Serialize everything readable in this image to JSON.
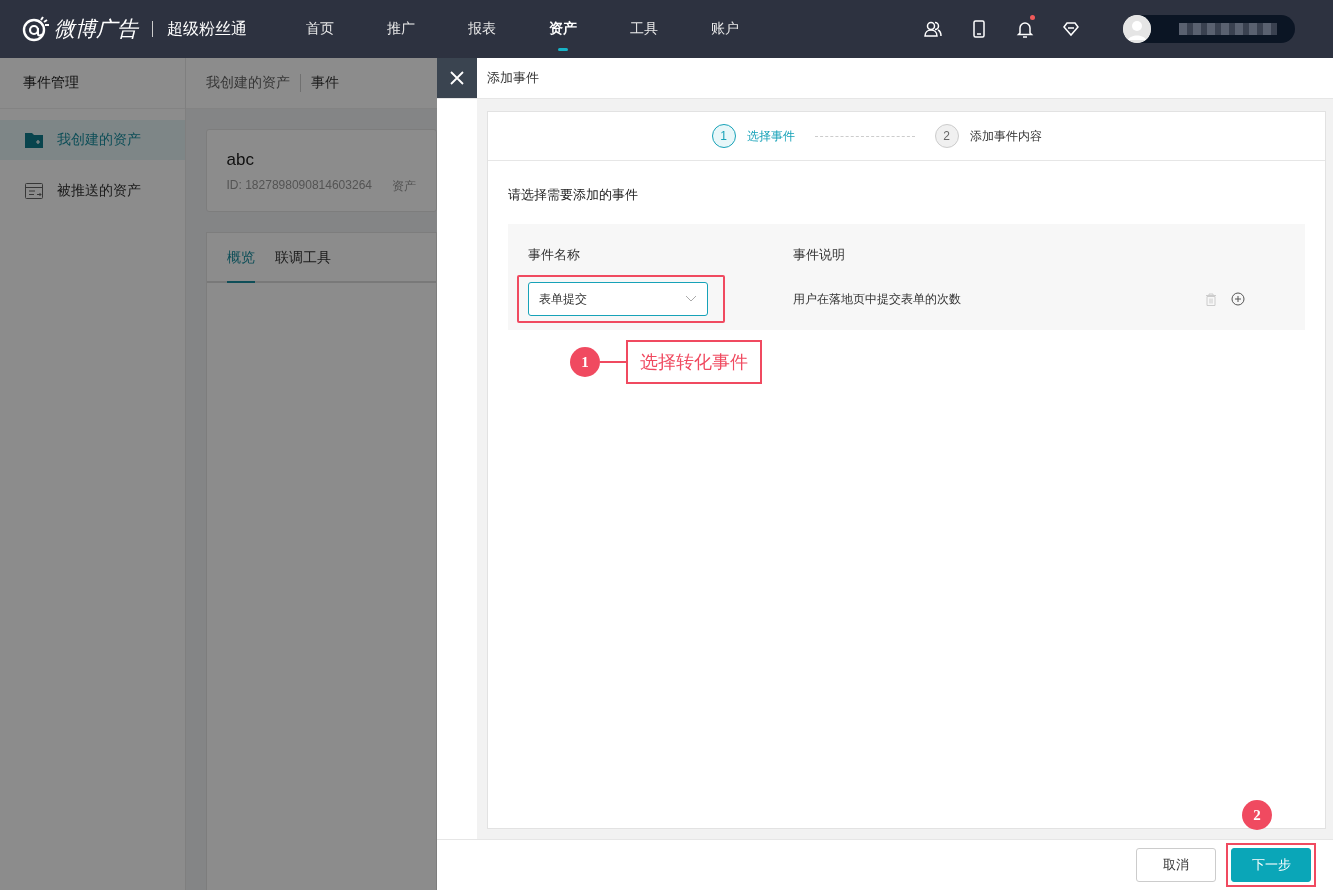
{
  "top_nav": {
    "logo": "微博广告",
    "product": "超级粉丝通",
    "items": [
      {
        "label": "首页",
        "selected": false
      },
      {
        "label": "推广",
        "selected": false
      },
      {
        "label": "报表",
        "selected": false
      },
      {
        "label": "资产",
        "selected": true
      },
      {
        "label": "工具",
        "selected": false
      },
      {
        "label": "账户",
        "selected": false
      }
    ],
    "notification_dot": true
  },
  "sidebar": {
    "title": "事件管理",
    "items": [
      {
        "label": "我创建的资产",
        "selected": true,
        "kind": "folder"
      },
      {
        "label": "被推送的资产",
        "selected": false,
        "kind": "inbox"
      }
    ]
  },
  "breadcrumb": [
    "我创建的资产",
    "事件"
  ],
  "asset_card": {
    "name": "abc",
    "id": "ID: 1827898090814603264",
    "field_3": "资产"
  },
  "tabs": [
    {
      "label": "概览",
      "selected": true
    },
    {
      "label": "联调工具",
      "selected": false
    }
  ],
  "drawer": {
    "title": "添加事件",
    "steps": [
      {
        "number": "1",
        "label": "选择事件",
        "selected": true
      },
      {
        "number": "2",
        "label": "添加事件内容",
        "selected": false
      }
    ],
    "prompt": "请选择需要添加的事件",
    "table": {
      "columns": [
        "事件名称",
        "事件说明"
      ],
      "rows": [
        {
          "event": "表单提交",
          "description": "用户在落地页中提交表单的次数"
        }
      ]
    },
    "buttons": [
      {
        "label": "取消",
        "kind": "default"
      },
      {
        "label": "下一步",
        "kind": "primary"
      }
    ]
  },
  "annotations": [
    {
      "number": "1",
      "text": "选择转化事件"
    },
    {
      "number": "2"
    }
  ]
}
